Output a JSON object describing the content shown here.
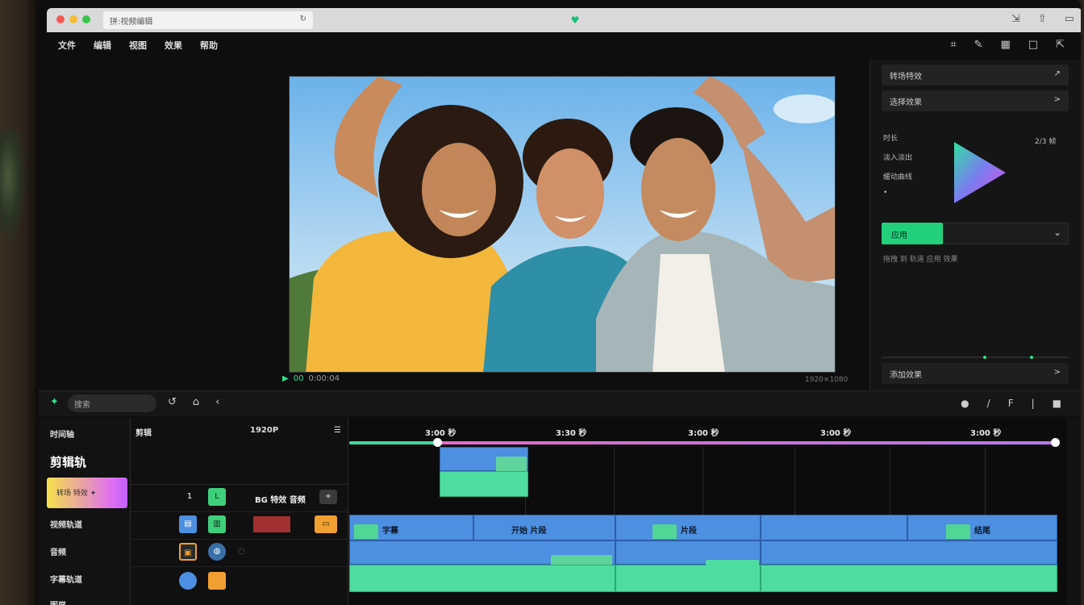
{
  "browser": {
    "url": "拼:视频编辑",
    "dots": [
      "#f35b52",
      "#f4bd3a",
      "#36c749"
    ]
  },
  "menu": {
    "items": [
      "文件",
      "编辑",
      "视图",
      "效果",
      "帮助"
    ]
  },
  "preview": {
    "info_a": "▶",
    "info_b": "00",
    "info_c": "0:00:04",
    "resolution": "1920×1080"
  },
  "right_panel": {
    "row1_label": "转场特效",
    "row1_icon": "↗",
    "row2_label": "选择效果",
    "row2_icon": ">",
    "meta_right": "2/3 帧",
    "props": [
      "时长",
      "淡入淡出",
      "缓动曲线",
      "•"
    ],
    "apply_label": "应用",
    "note": "拖拽 到 轨道 应用 效果",
    "bottom_label": "添加效果",
    "bottom_icon": ">"
  },
  "toolbar": {
    "search": "搜索",
    "right_icons": [
      "●",
      "/",
      "F",
      "|",
      "■"
    ]
  },
  "tracks": {
    "head_title": "时间轴",
    "big_title": "剪辑轨",
    "grad_label": "转场 特效 ✦",
    "items": [
      "视频轨道",
      "音频",
      "字幕轨道",
      "图层"
    ]
  },
  "mid": {
    "head_a": "剪辑",
    "head_b": "1920P",
    "row1_text": "BG 特效 音频",
    "row1_num": "1"
  },
  "timeline": {
    "ticks": [
      "3:00 秒",
      "3:30 秒",
      "3:00 秒",
      "3:00 秒",
      "3:00 秒"
    ],
    "clips": [
      "字幕",
      "开始 片段",
      "片段",
      "结尾"
    ]
  },
  "colors": {
    "accent": "#2ee08c",
    "clip_blue": "#4d8fe0",
    "clip_green": "#4fdca0"
  }
}
